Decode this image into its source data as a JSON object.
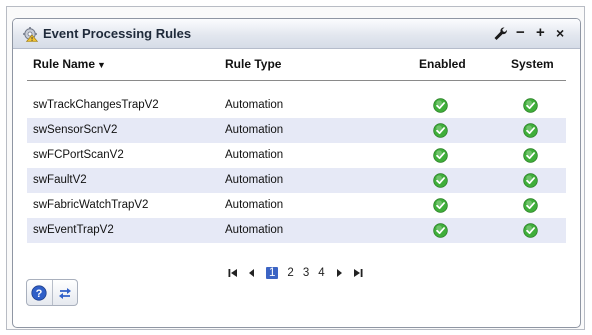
{
  "portlet": {
    "title": "Event Processing Rules",
    "controls": {
      "minimize": "−",
      "maximize": "+",
      "close": "×"
    }
  },
  "table": {
    "columns": [
      "Rule Name",
      "Rule Type",
      "Enabled",
      "System"
    ],
    "sort_indicator": "▼",
    "rows": [
      {
        "name": "swTrackChangesTrapV2",
        "type": "Automation",
        "enabled": true,
        "system": true
      },
      {
        "name": "swSensorScnV2",
        "type": "Automation",
        "enabled": true,
        "system": true
      },
      {
        "name": "swFCPortScanV2",
        "type": "Automation",
        "enabled": true,
        "system": true
      },
      {
        "name": "swFaultV2",
        "type": "Automation",
        "enabled": true,
        "system": true
      },
      {
        "name": "swFabricWatchTrapV2",
        "type": "Automation",
        "enabled": true,
        "system": true
      },
      {
        "name": "swEventTrapV2",
        "type": "Automation",
        "enabled": true,
        "system": true
      }
    ]
  },
  "pagination": {
    "pages": [
      "1",
      "2",
      "3",
      "4"
    ],
    "current": "1"
  },
  "colors": {
    "check_green": "#3fae3a",
    "row_alt": "#e6e9f6",
    "current_page": "#3c64c4"
  },
  "icons": [
    "gear-alert-icon",
    "wrench-icon",
    "help-icon",
    "refresh-icon",
    "first-page-icon",
    "prev-page-icon",
    "next-page-icon",
    "last-page-icon",
    "check-icon"
  ]
}
